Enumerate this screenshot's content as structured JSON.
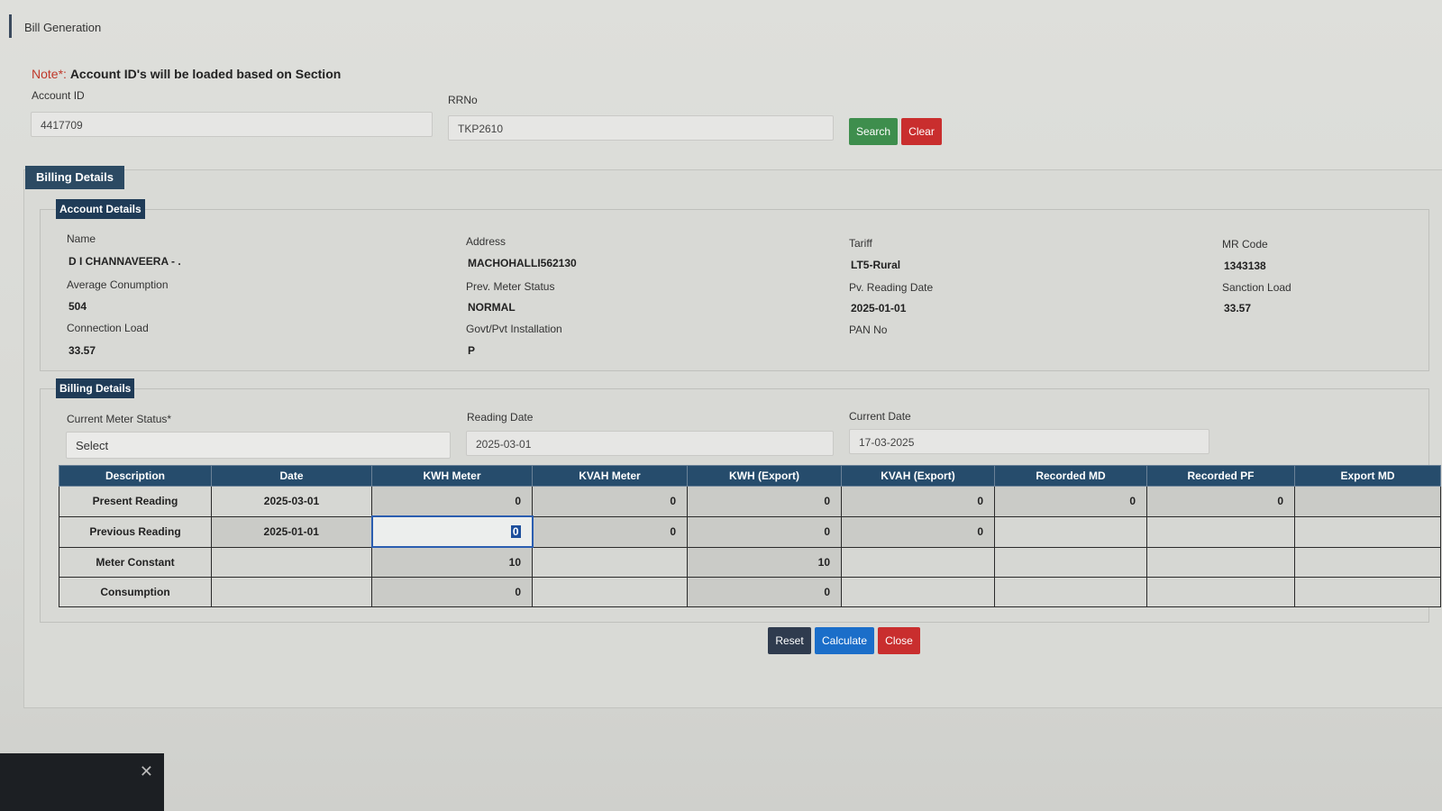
{
  "page": {
    "title": "Bill Generation"
  },
  "note": {
    "prefix": "Note*:",
    "text": "Account ID's will be loaded based on Section"
  },
  "search": {
    "account_label": "Account ID",
    "account_value": "4417709",
    "rrno_label": "RRNo",
    "rrno_value": "TKP2610",
    "search_label": "Search",
    "clear_label": "Clear"
  },
  "billing_tab": "Billing Details",
  "account_details": {
    "header": "Account Details",
    "fields": {
      "name_label": "Name",
      "name_value": "D I CHANNAVEERA - .",
      "address_label": "Address",
      "address_value": "MACHOHALLI562130",
      "tariff_label": "Tariff",
      "tariff_value": "LT5-Rural",
      "mrcode_label": "MR Code",
      "mrcode_value": "1343138",
      "avg_label": "Average Conumption",
      "avg_value": "504",
      "prev_status_label": "Prev. Meter Status",
      "prev_status_value": "NORMAL",
      "pv_date_label": "Pv. Reading Date",
      "pv_date_value": "2025-01-01",
      "sanction_label": "Sanction Load",
      "sanction_value": "33.57",
      "conn_label": "Connection Load",
      "conn_value": "33.57",
      "govt_label": "Govt/Pvt Installation",
      "govt_value": "P",
      "pan_label": "PAN No",
      "pan_value": ""
    }
  },
  "billing_details": {
    "header": "Billing Details",
    "meter_status_label": "Current Meter Status*",
    "meter_status_value": "Select",
    "reading_date_label": "Reading Date",
    "reading_date_value": "2025-03-01",
    "current_date_label": "Current Date",
    "current_date_value": "17-03-2025"
  },
  "grid": {
    "columns": [
      "Description",
      "Date",
      "KWH Meter",
      "KVAH Meter",
      "KWH (Export)",
      "KVAH (Export)",
      "Recorded MD",
      "Recorded PF",
      "Export MD"
    ],
    "rows": [
      {
        "desc": "Present Reading",
        "date": "2025-03-01",
        "kwh": "0",
        "kvah": "0",
        "kwh_exp": "0",
        "kvah_exp": "0",
        "rec_md": "0",
        "rec_pf": "0",
        "exp_md": ""
      },
      {
        "desc": "Previous Reading",
        "date": "2025-01-01",
        "kwh": "0",
        "kvah": "0",
        "kwh_exp": "0",
        "kvah_exp": "0",
        "rec_md": "",
        "rec_pf": "",
        "exp_md": ""
      },
      {
        "desc": "Meter Constant",
        "date": "",
        "kwh": "10",
        "kvah": "",
        "kwh_exp": "10",
        "kvah_exp": "",
        "rec_md": "",
        "rec_pf": "",
        "exp_md": ""
      },
      {
        "desc": "Consumption",
        "date": "",
        "kwh": "0",
        "kvah": "",
        "kwh_exp": "0",
        "kvah_exp": "",
        "rec_md": "",
        "rec_pf": "",
        "exp_md": ""
      }
    ]
  },
  "actions": {
    "reset": "Reset",
    "calculate": "Calculate",
    "close": "Close"
  },
  "toast": {
    "close_icon": "close-icon",
    "close_glyph": "✕"
  }
}
